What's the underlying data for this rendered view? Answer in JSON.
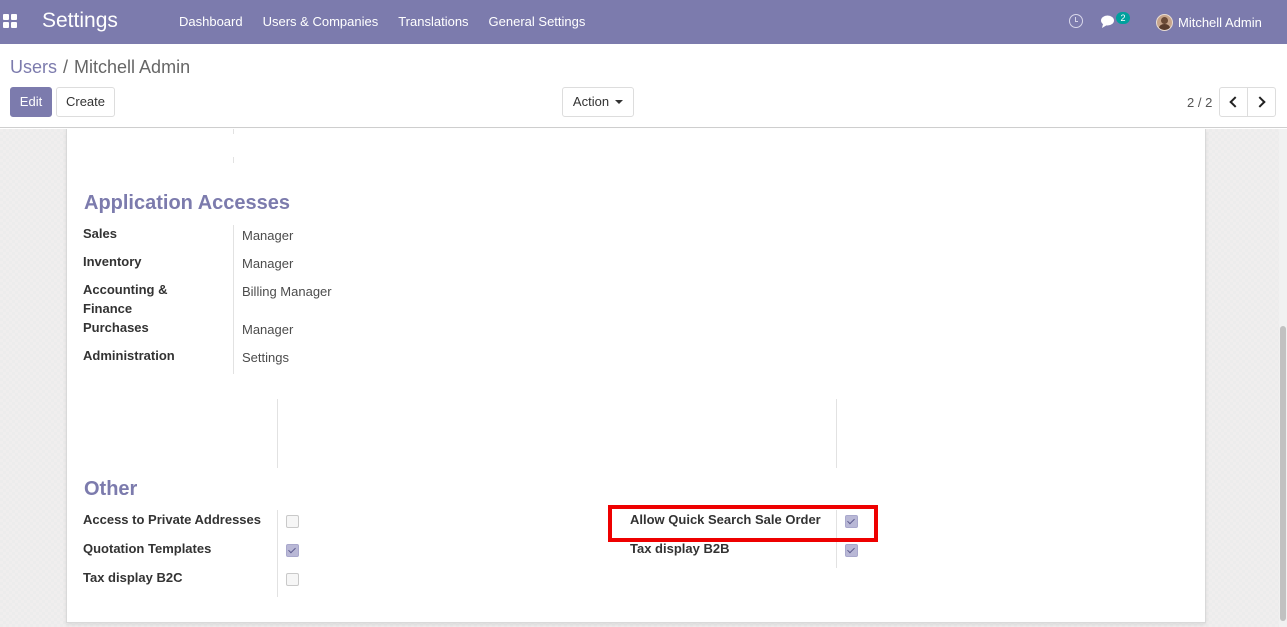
{
  "navbar": {
    "app_title": "Settings",
    "menu": [
      "Dashboard",
      "Users & Companies",
      "Translations",
      "General Settings"
    ],
    "chat_count": "2",
    "user_name": "Mitchell Admin"
  },
  "breadcrumb": {
    "parent": "Users",
    "separator": "/",
    "current": "Mitchell Admin"
  },
  "buttons": {
    "edit": "Edit",
    "create": "Create",
    "action": "Action"
  },
  "pager": {
    "value": "2 / 2"
  },
  "application_accesses": {
    "title": "Application Accesses",
    "fields": [
      {
        "label": "Sales",
        "value": "Manager"
      },
      {
        "label": "Inventory",
        "value": "Manager"
      },
      {
        "label": "Accounting & Finance",
        "value": "Billing Manager"
      },
      {
        "label": "Purchases",
        "value": "Manager"
      },
      {
        "label": "Administration",
        "value": "Settings"
      }
    ]
  },
  "other": {
    "title": "Other",
    "left": [
      {
        "label": "Access to Private Addresses",
        "checked": false
      },
      {
        "label": "Quotation Templates",
        "checked": true
      },
      {
        "label": "Tax display B2C",
        "checked": false
      }
    ],
    "right": [
      {
        "label": "Allow Quick Search Sale Order",
        "checked": true
      },
      {
        "label": "Tax display B2B",
        "checked": true
      }
    ]
  },
  "colors": {
    "brand": "#7c7bad",
    "highlight": "#ee0000",
    "badge": "#00a09d"
  }
}
